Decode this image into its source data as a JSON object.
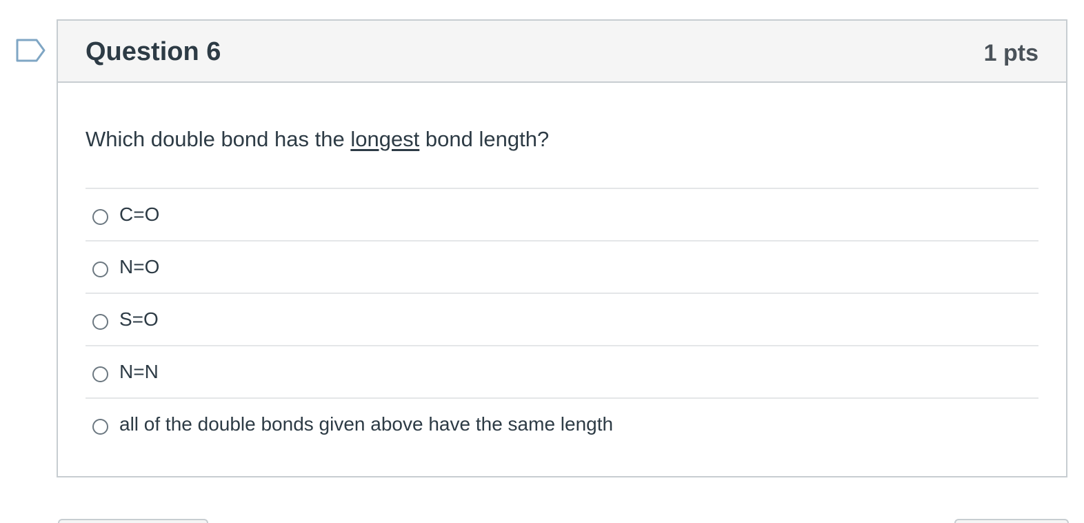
{
  "question": {
    "title": "Question 6",
    "points": "1 pts",
    "text_before": "Which double bond has the ",
    "text_emphasis": "longest",
    "text_after": " bond length?"
  },
  "answers": [
    {
      "label": "C=O"
    },
    {
      "label": "N=O"
    },
    {
      "label": "S=O"
    },
    {
      "label": "N=N"
    },
    {
      "label": "all of the double bonds given above have the same length"
    }
  ],
  "icons": {
    "flag": "flag-icon"
  },
  "colors": {
    "text": "#2d3b45",
    "border": "#c7cdd1",
    "header_bg": "#f5f5f5",
    "flag_stroke": "#7fa6c4"
  }
}
